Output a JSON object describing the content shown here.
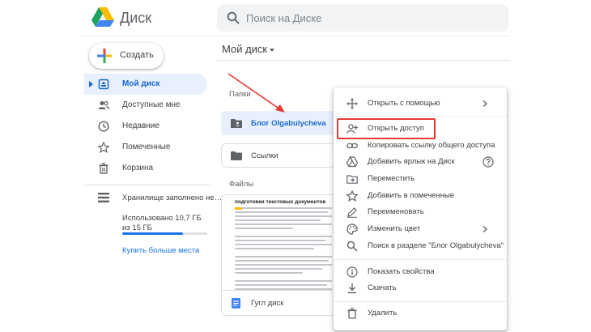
{
  "header": {
    "app_name": "Диск",
    "search": {
      "placeholder": "Поиск на Диске"
    }
  },
  "sidebar": {
    "create_label": "Создать",
    "items": [
      {
        "label": "Мой диск",
        "icon": "my-drive-icon",
        "active": true
      },
      {
        "label": "Доступные мне",
        "icon": "shared-people-icon",
        "active": false
      },
      {
        "label": "Недавние",
        "icon": "clock-icon",
        "active": false
      },
      {
        "label": "Помеченные",
        "icon": "star-icon",
        "active": false
      },
      {
        "label": "Корзина",
        "icon": "trash-icon",
        "active": false
      }
    ],
    "storage": {
      "label": "Хранилище заполнено не…",
      "used_text": "Использовано 10,7 ГБ из 15 ГБ",
      "used_fraction": 0.71,
      "buy_more": "Купить больше места"
    }
  },
  "main": {
    "title": "Мой диск",
    "folders_heading": "Папки",
    "folders": [
      {
        "name": "Блог Olgabulycheva",
        "selected": true
      },
      {
        "name": "Ссылки",
        "selected": false
      }
    ],
    "files_heading": "Файлы",
    "files": [
      {
        "name": "Гугл диск",
        "preview_heading": "подготовки текстовых документов"
      }
    ]
  },
  "context_menu": {
    "items": [
      {
        "label": "Открыть с помощью",
        "icon": "open-with-icon",
        "submenu": true
      },
      {
        "label": "Открыть доступ",
        "icon": "share-person-add-icon",
        "highlighted": true
      },
      {
        "label": "Копировать ссылку общего доступа",
        "icon": "link-icon"
      },
      {
        "label": "Добавить ярлык на Диск",
        "icon": "add-shortcut-icon",
        "help": true
      },
      {
        "label": "Переместить",
        "icon": "move-folder-icon"
      },
      {
        "label": "Добавить в помеченные",
        "icon": "star-icon"
      },
      {
        "label": "Переименовать",
        "icon": "pencil-icon"
      },
      {
        "label": "Изменить цвет",
        "icon": "palette-icon",
        "submenu": true
      },
      {
        "label": "Поиск в разделе \"Блог Olgabulycheva\"",
        "icon": "search-icon"
      },
      {
        "label": "Показать свойства",
        "icon": "info-icon"
      },
      {
        "label": "Скачать",
        "icon": "download-icon"
      },
      {
        "label": "Удалить",
        "icon": "trash-icon"
      }
    ]
  },
  "colors": {
    "accent": "#1a73e8",
    "active_bg": "#e8f0fe",
    "highlight_border": "#e53935"
  }
}
